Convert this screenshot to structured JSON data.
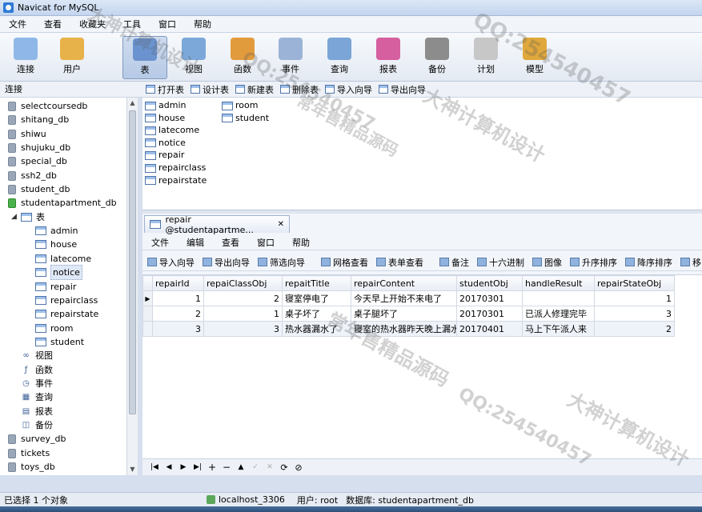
{
  "window": {
    "title": "Navicat for MySQL"
  },
  "menubar": [
    "文件",
    "查看",
    "收藏夹",
    "工具",
    "窗口",
    "帮助"
  ],
  "toolbar": [
    {
      "label": "连接",
      "icon": "connection-icon",
      "active": false
    },
    {
      "label": "用户",
      "icon": "user-icon",
      "active": false
    },
    {
      "label": "表",
      "icon": "table-icon",
      "active": true
    },
    {
      "label": "视图",
      "icon": "view-icon",
      "active": false
    },
    {
      "label": "函数",
      "icon": "function-icon",
      "active": false
    },
    {
      "label": "事件",
      "icon": "event-icon",
      "active": false
    },
    {
      "label": "查询",
      "icon": "query-icon",
      "active": false
    },
    {
      "label": "报表",
      "icon": "report-icon",
      "active": false
    },
    {
      "label": "备份",
      "icon": "backup-icon",
      "active": false
    },
    {
      "label": "计划",
      "icon": "schedule-icon",
      "active": false
    },
    {
      "label": "模型",
      "icon": "model-icon",
      "active": false
    }
  ],
  "sidebar": {
    "header": "连接",
    "databases_top": [
      "selectcoursedb",
      "shitang_db",
      "shiwu",
      "shujuku_db",
      "special_db",
      "ssh2_db",
      "student_db"
    ],
    "open_db": "studentapartment_db",
    "tables_node": "表",
    "tables": [
      "admin",
      "house",
      "latecome",
      "notice",
      "repair",
      "repairclass",
      "repairstate",
      "room",
      "student"
    ],
    "selected_table": "notice",
    "other_nodes": [
      {
        "label": "视图",
        "icon": "view-icon"
      },
      {
        "label": "函数",
        "icon": "function-icon"
      },
      {
        "label": "事件",
        "icon": "event-icon"
      },
      {
        "label": "查询",
        "icon": "query-icon"
      },
      {
        "label": "报表",
        "icon": "report-icon"
      },
      {
        "label": "备份",
        "icon": "backup-icon"
      }
    ],
    "databases_bottom": [
      "survey_db",
      "tickets",
      "toys_db"
    ]
  },
  "object_toolbar": [
    "打开表",
    "设计表",
    "新建表",
    "删除表",
    "导入向导",
    "导出向导"
  ],
  "object_list": {
    "col1": [
      "admin",
      "house",
      "latecome",
      "notice",
      "repair",
      "repairclass",
      "repairstate"
    ],
    "col2": [
      "room",
      "student"
    ]
  },
  "sub_window": {
    "tab_title": "repair @studentapartme...",
    "menubar": [
      "文件",
      "编辑",
      "查看",
      "窗口",
      "帮助"
    ],
    "toolbar": [
      "导入向导",
      "导出向导",
      "筛选向导",
      "网格查看",
      "表单查看",
      "备注",
      "十六进制",
      "图像",
      "升序排序",
      "降序排序",
      "移"
    ],
    "grid": {
      "columns": [
        "repairId",
        "repaiClassObj",
        "repaitTitle",
        "repairContent",
        "studentObj",
        "handleResult",
        "repairStateObj"
      ],
      "rows": [
        [
          "1",
          "2",
          "寝室停电了",
          "今天早上开始不来电了",
          "20170301",
          "",
          "1"
        ],
        [
          "2",
          "1",
          "桌子坏了",
          "桌子腿坏了",
          "20170301",
          "已派人修理完毕",
          "3"
        ],
        [
          "3",
          "3",
          "热水器漏水了",
          "寝室的热水器昨天晚上漏水",
          "20170401",
          "马上下午派人来",
          "2"
        ]
      ]
    }
  },
  "statusbar": {
    "selection": "已选择 1 个对象",
    "host": "localhost_3306",
    "user": "用户: root",
    "database": "数据库: studentapartment_db"
  },
  "watermarks": [
    "大神计算机设计",
    "QQ:254540457",
    "常年售精品源码",
    "大神计算机设计",
    "QQ:254540457",
    "常年售精品源码",
    "QQ:254540457",
    "大神计算机设计"
  ]
}
